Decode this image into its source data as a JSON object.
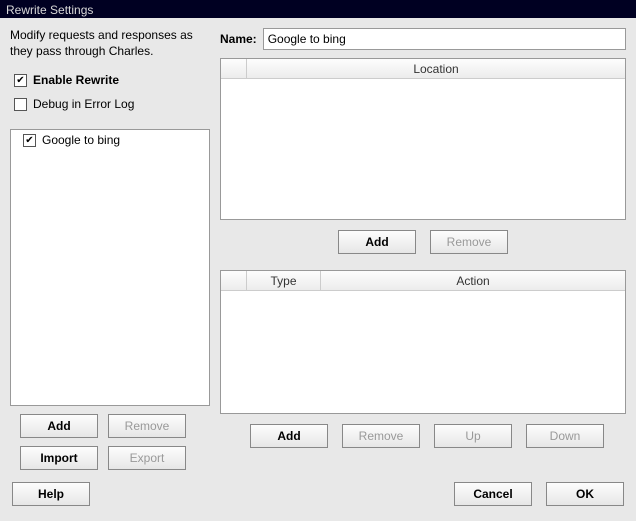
{
  "window": {
    "title": "Rewrite Settings"
  },
  "intro": "Modify requests and responses as they pass through Charles.",
  "checkboxes": {
    "enable": {
      "label": "Enable Rewrite",
      "checked": true
    },
    "debug": {
      "label": "Debug in Error Log",
      "checked": false
    }
  },
  "rules": [
    {
      "label": "Google to bing",
      "checked": true
    }
  ],
  "ruleButtons": {
    "add": "Add",
    "remove": "Remove",
    "import": "Import",
    "export": "Export"
  },
  "name": {
    "label": "Name:",
    "value": "Google to bing"
  },
  "locationTable": {
    "columns": {
      "stub": "",
      "location": "Location"
    },
    "rows": [],
    "buttons": {
      "add": "Add",
      "remove": "Remove"
    }
  },
  "actionTable": {
    "columns": {
      "stub": "",
      "type": "Type",
      "action": "Action"
    },
    "rows": [],
    "buttons": {
      "add": "Add",
      "remove": "Remove",
      "up": "Up",
      "down": "Down"
    }
  },
  "footer": {
    "help": "Help",
    "cancel": "Cancel",
    "ok": "OK"
  }
}
